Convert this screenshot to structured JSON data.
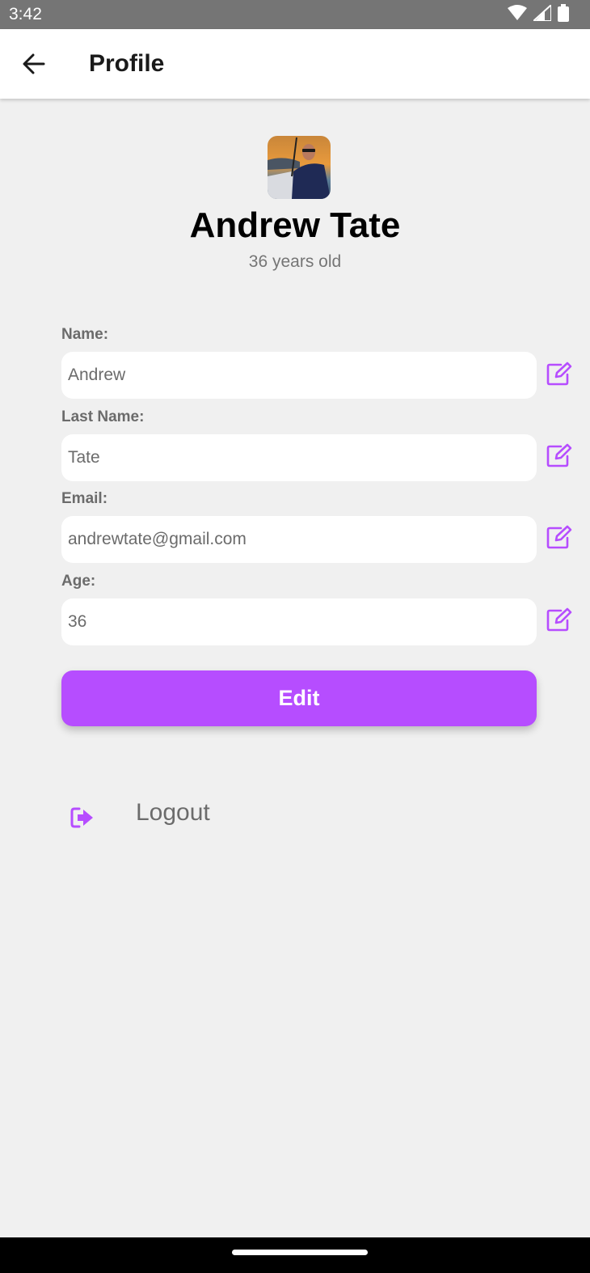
{
  "status_bar": {
    "time": "3:42"
  },
  "app_bar": {
    "title": "Profile"
  },
  "profile": {
    "name": "Andrew Tate",
    "age_text": "36 years old"
  },
  "form": {
    "name": {
      "label": "Name:",
      "value": "Andrew"
    },
    "last_name": {
      "label": "Last Name:",
      "value": "Tate"
    },
    "email": {
      "label": "Email:",
      "value": "andrewtate@gmail.com"
    },
    "age": {
      "label": "Age:",
      "value": "36"
    }
  },
  "edit_button": {
    "label": "Edit"
  },
  "logout": {
    "label": "Logout"
  },
  "colors": {
    "accent": "#b64dff",
    "background": "#f0f0f0",
    "status_bar": "#757575"
  },
  "icons": [
    "back-arrow-icon",
    "pencil-square-icon",
    "logout-icon",
    "wifi-icon",
    "signal-icon",
    "battery-icon"
  ]
}
